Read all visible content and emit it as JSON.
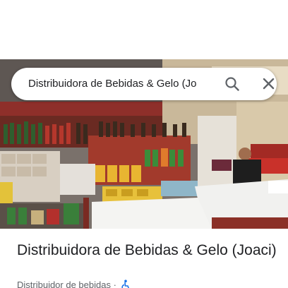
{
  "search": {
    "query": "Distribuidora de Bebidas & Gelo (Jo"
  },
  "place": {
    "name": "Distribuidora de Bebidas & Gelo (Joaci)",
    "category": "Distribuidor de bebidas",
    "separator": "·"
  },
  "colors": {
    "accent_blue": "#1a73e8",
    "text_primary": "#202124",
    "text_secondary": "#5f6368"
  },
  "icons": {
    "search": "search-icon",
    "close": "close-icon",
    "accessibility": "wheelchair-accessible-icon"
  }
}
